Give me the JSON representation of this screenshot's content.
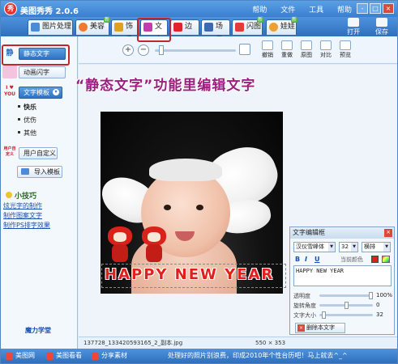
{
  "app": {
    "title": "美图秀秀 2.0.6",
    "logo_text": "秀",
    "title_menus": [
      "帮助",
      "文件",
      "工具",
      "帮助"
    ],
    "window_controls": [
      "-",
      "□",
      "×"
    ]
  },
  "tabs": [
    {
      "label": "图片处理",
      "icon": "image-icon",
      "color": "#4a8cd8",
      "new": false
    },
    {
      "label": "美容",
      "icon": "heart-icon",
      "color": "#f07a30",
      "new": true
    },
    {
      "label": "饰品",
      "icon": "bowtie-icon",
      "color": "#e0a020",
      "new": false
    },
    {
      "label": "文字",
      "icon": "text-icon",
      "color": "#c43bb0",
      "new": false,
      "active": true
    },
    {
      "label": "边框",
      "icon": "frame-icon",
      "color": "#e0242a",
      "new": false
    },
    {
      "label": "场景",
      "icon": "scene-icon",
      "color": "#3b6ab0",
      "new": false
    },
    {
      "label": "闪图",
      "icon": "flash-icon",
      "color": "#e63a3a",
      "new": true
    },
    {
      "label": "娃娃",
      "icon": "doll-icon",
      "color": "#f0a030",
      "new": true
    }
  ],
  "new_badge": "新",
  "top_buttons": [
    {
      "label": "打开",
      "icon": "folder-icon"
    },
    {
      "label": "保存",
      "icon": "save-icon"
    }
  ],
  "left_panel": {
    "static_text": {
      "icon_text": "静",
      "label": "静态文字"
    },
    "animated_text": {
      "label": "动画闪字"
    },
    "text_template": {
      "icon_text": "I ♥ YOU",
      "label": "文字模板"
    },
    "template_items": [
      "快乐",
      "优伤",
      "其他"
    ],
    "user_custom": {
      "icon_text": "用户自定义",
      "label": "用户自定义"
    },
    "import_template": {
      "label": "导入模板"
    },
    "tips_heading": "小技巧",
    "tip_links": [
      "炫光字的制作",
      "制作图案文字",
      "制作PS排字效果"
    ],
    "magic_school": "魔力学堂"
  },
  "toolbar": {
    "zoom_in": "+",
    "zoom_out": "−",
    "zoom_level": 0.05,
    "buttons": [
      "撤销",
      "重做",
      "原图",
      "对比",
      "预览"
    ]
  },
  "canvas": {
    "headline": "“静态文字”功能里编辑文字",
    "overlay_text": "HAPPY NEW YEAR"
  },
  "editor": {
    "title": "文字编辑框",
    "close": "×",
    "font": "汉仪雪峰体",
    "size": "32",
    "orientation": "横排",
    "format_buttons": [
      "B",
      "I",
      "U"
    ],
    "current_color_label": "当前颜色",
    "current_color": "#e0201c",
    "text_value": "HAPPY NEW YEAR",
    "opacity_label": "透明度",
    "opacity_value": "100%",
    "opacity": 1.0,
    "rotation_label": "旋转角度",
    "rotation_value": "0",
    "rotation": 0.5,
    "font_size_label": "文字大小",
    "font_size_value": "32",
    "font_size_level": 0.05,
    "delete_label": "删除本文字"
  },
  "status": {
    "filename": "137728_133420593165_2_副本.jpg",
    "dimensions": "550 × 353"
  },
  "bottom_bar": {
    "items": [
      {
        "label": "美图网",
        "color": "#e84a3a"
      },
      {
        "label": "美图看看",
        "color": "#e84a3a"
      },
      {
        "label": "分享素材",
        "color": "#e84a3a"
      }
    ],
    "message": "处理好的照片别浪费，印成2010年个性台历吧！马上就去^_^"
  }
}
